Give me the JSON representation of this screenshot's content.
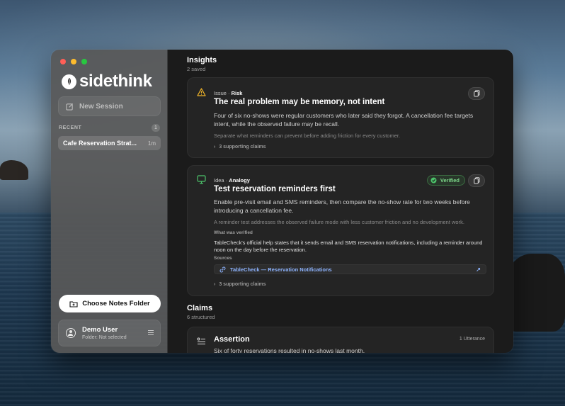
{
  "app": {
    "name": "sidethink"
  },
  "sidebar": {
    "new_session_label": "New Session",
    "recent_label": "RECENT",
    "recent_count": "1",
    "sessions": [
      {
        "title": "Cafe Reservation Strat...",
        "time": "1m"
      }
    ],
    "choose_folder_label": "Choose Notes Folder",
    "user": {
      "name": "Demo User",
      "folder": "Folder: Not selected"
    }
  },
  "insights": {
    "title": "Insights",
    "count": "2 saved",
    "items": [
      {
        "kind": "Issue",
        "subkind": "Risk",
        "title": "The real problem may be memory, not intent",
        "body": "Four of six no-shows were regular customers who later said they forgot. A cancellation fee targets intent, while the observed failure may be recall.",
        "note": "Separate what reminders can prevent before adding friction for every customer.",
        "supporting": "3 supporting claims"
      },
      {
        "kind": "Idea",
        "subkind": "Analogy",
        "title": "Test reservation reminders first",
        "badge": "Verified",
        "body": "Enable pre-visit email and SMS reminders, then compare the no-show rate for two weeks before introducing a cancellation fee.",
        "note": "A reminder test addresses the observed failure mode with less customer friction and no development work.",
        "verified_label": "What was verified",
        "verified_text": "TableCheck's official help states that it sends email and SMS reservation notifications, including a reminder around noon on the day before the reservation.",
        "sources_label": "Sources",
        "source": "TableCheck — Reservation Notifications",
        "supporting": "3 supporting claims"
      }
    ]
  },
  "claims": {
    "title": "Claims",
    "count": "6 structured",
    "items": [
      {
        "type": "Assertion",
        "meta": "1 Utterance",
        "text": "Six of forty reservations resulted in no-shows last month."
      }
    ]
  },
  "colors": {
    "warning": "#f0b429",
    "idea": "#4cc36a",
    "verified": "#7dd98a",
    "link": "#8eb4ff"
  }
}
